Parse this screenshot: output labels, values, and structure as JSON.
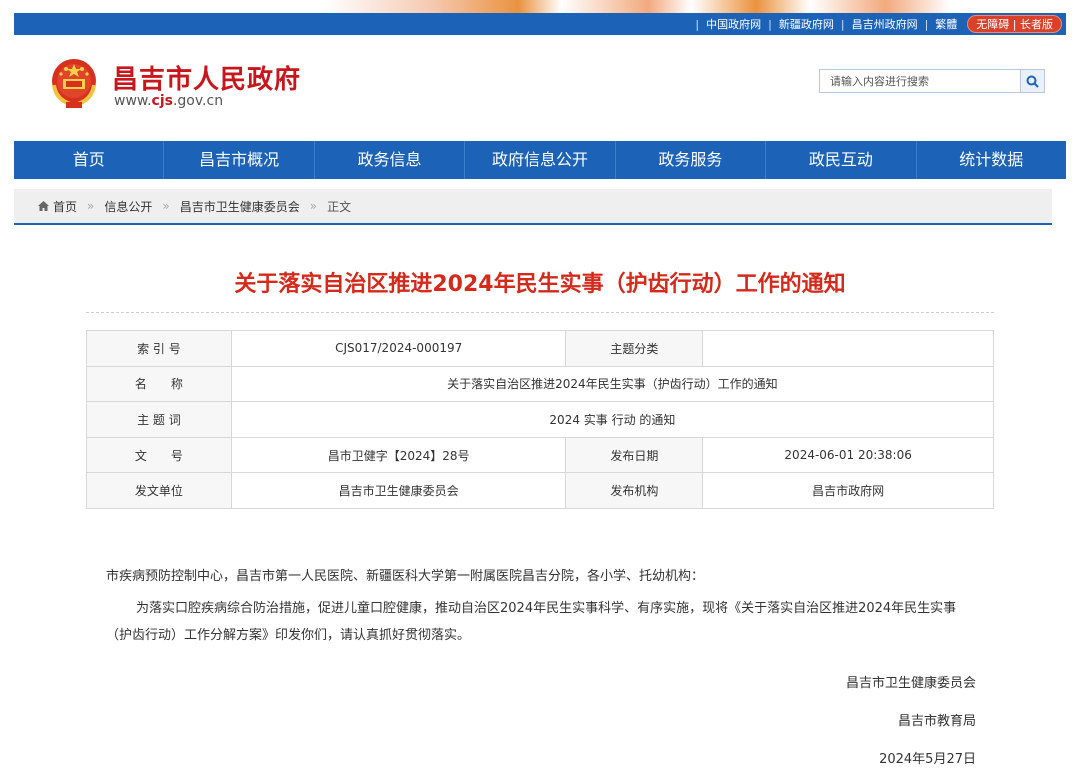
{
  "topbar": {
    "links": [
      "中国政府网",
      "新疆政府网",
      "昌吉州政府网",
      "繁體"
    ],
    "access_button": "无障碍 | 长者版"
  },
  "header": {
    "site_title": "昌吉市人民政府",
    "site_url_prefix": "www.",
    "site_url_domain": "cjs",
    "site_url_suffix": ".gov.cn",
    "search_placeholder": "请输入内容进行搜索"
  },
  "nav": {
    "items": [
      "首页",
      "昌吉市概况",
      "政务信息",
      "政府信息公开",
      "政务服务",
      "政民互动",
      "统计数据"
    ]
  },
  "breadcrumb": {
    "items": [
      "首页",
      "信息公开",
      "昌吉市卫生健康委员会",
      "正文"
    ]
  },
  "article": {
    "title": "关于落实自治区推进2024年民生实事（护齿行动）工作的通知"
  },
  "meta": {
    "index_label": "索 引 号",
    "index_value": "CJS017/2024-000197",
    "category_label": "主题分类",
    "category_value": "",
    "name_label": "名　　称",
    "name_value": "关于落实自治区推进2024年民生实事（护齿行动）工作的通知",
    "keywords_label": "主 题 词",
    "keywords_value": "2024 实事 行动 的通知",
    "docno_label": "文　　号",
    "docno_value": "昌市卫健字【2024】28号",
    "date_label": "发布日期",
    "date_value": "2024-06-01 20:38:06",
    "issuer_label": "发文单位",
    "issuer_value": "昌吉市卫生健康委员会",
    "publisher_label": "发布机构",
    "publisher_value": "昌吉市政府网"
  },
  "content": {
    "salutation": "市疾病预防控制中心，昌吉市第一人民医院、新疆医科大学第一附属医院昌吉分院，各小学、托幼机构：",
    "paragraph": "为落实口腔疾病综合防治措施，促进儿童口腔健康，推动自治区2024年民生实事科学、有序实施，现将《关于落实自治区推进2024年民生实事（护齿行动）工作分解方案》印发你们，请认真抓好贯彻落实。",
    "signer1": "昌吉市卫生健康委员会",
    "signer2": "昌吉市教育局",
    "sign_date": "2024年5月27日"
  },
  "colors": {
    "brand_blue": "#1c63b7",
    "title_red": "#d42a1c",
    "logo_red": "#c8161d"
  }
}
